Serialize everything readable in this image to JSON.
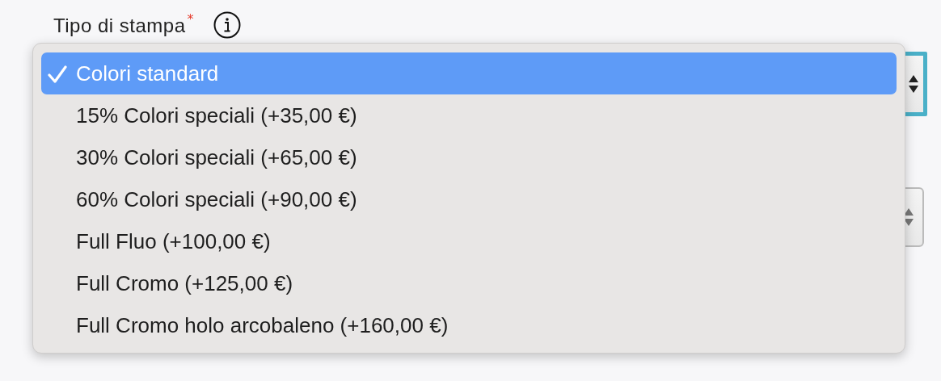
{
  "field": {
    "label": "Tipo di stampa",
    "required": true,
    "required_mark": "*"
  },
  "dropdown": {
    "options": [
      {
        "label": "Colori standard",
        "selected": true
      },
      {
        "label": "15% Colori speciali (+35,00 €)",
        "selected": false
      },
      {
        "label": "30% Colori speciali (+65,00 €)",
        "selected": false
      },
      {
        "label": "60% Colori speciali (+90,00 €)",
        "selected": false
      },
      {
        "label": "Full Fluo (+100,00 €)",
        "selected": false
      },
      {
        "label": "Full Cromo (+125,00 €)",
        "selected": false
      },
      {
        "label": "Full Cromo holo arcobaleno (+160,00 €)",
        "selected": false
      }
    ]
  }
}
